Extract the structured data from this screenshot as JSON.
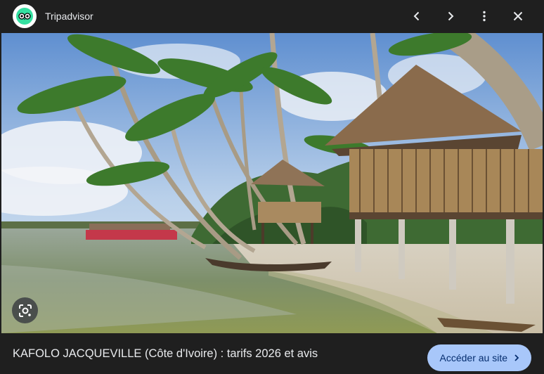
{
  "header": {
    "site_name": "Tripadvisor",
    "logo_icon": "tripadvisor-owl-icon",
    "actions": [
      {
        "icon": "chevron-left-icon",
        "label": "Previous"
      },
      {
        "icon": "chevron-right-icon",
        "label": "Next"
      },
      {
        "icon": "more-vert-icon",
        "label": "More options"
      },
      {
        "icon": "close-icon",
        "label": "Close"
      }
    ]
  },
  "image": {
    "lens_icon": "google-lens-icon"
  },
  "footer": {
    "caption": "KAFOLO JACQUEVILLE (Côte d'Ivoire) : tarifs 2026 et avis",
    "visit_button_label": "Accéder au site",
    "visit_button_icon": "chevron-right-icon"
  },
  "colors": {
    "background": "#1f1f1f",
    "text": "#e8eaed",
    "button_bg": "#a8c7fa",
    "button_text": "#062e6f",
    "brand_green": "#34e0a1"
  }
}
